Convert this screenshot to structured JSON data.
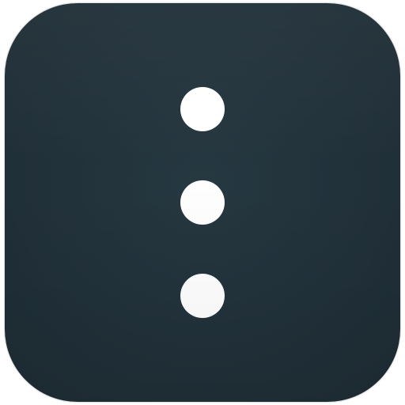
{
  "icon": {
    "name": "more-vertical-icon",
    "background_color": "#22323b",
    "dot_color": "#ffffff",
    "dot_count": 3
  }
}
